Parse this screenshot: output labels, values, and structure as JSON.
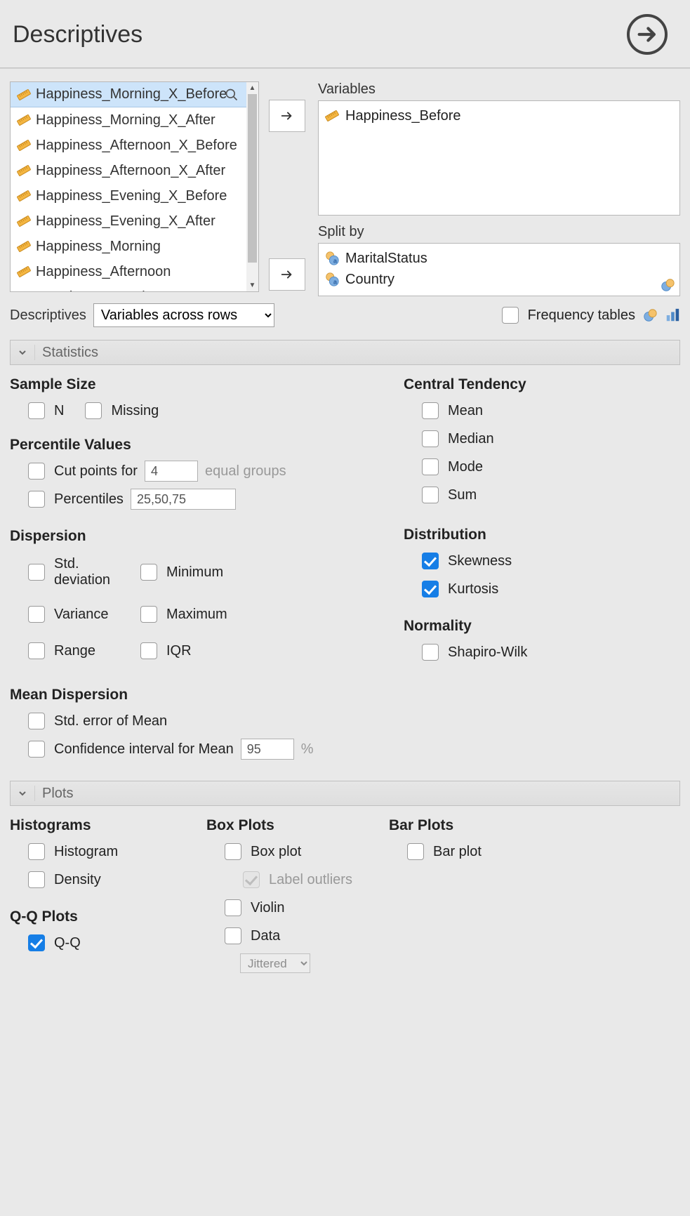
{
  "header": {
    "title": "Descriptives"
  },
  "source_vars": [
    "Happiness_Morning_X_Before",
    "Happiness_Morning_X_After",
    "Happiness_Afternoon_X_Before",
    "Happiness_Afternoon_X_After",
    "Happiness_Evening_X_Before",
    "Happiness_Evening_X_After",
    "Happiness_Morning",
    "Happiness_Afternoon",
    "Happiness_Evening"
  ],
  "targets": {
    "variables_label": "Variables",
    "variables": [
      "Happiness_Before"
    ],
    "split_label": "Split by",
    "split": [
      "MaritalStatus",
      "Country"
    ]
  },
  "layout_row": {
    "label": "Descriptives",
    "combo_value": "Variables across rows",
    "freq_label": "Frequency tables"
  },
  "sections": {
    "statistics": {
      "title": "Statistics",
      "sample_size": {
        "title": "Sample Size",
        "n": "N",
        "missing": "Missing"
      },
      "percentile": {
        "title": "Percentile Values",
        "cutpoints": "Cut points for",
        "cutpoints_val": "4",
        "equal_groups": "equal groups",
        "percentiles": "Percentiles",
        "percentiles_val": "25,50,75"
      },
      "dispersion": {
        "title": "Dispersion",
        "std": "Std. deviation",
        "min": "Minimum",
        "var": "Variance",
        "max": "Maximum",
        "range": "Range",
        "iqr": "IQR"
      },
      "mean_disp": {
        "title": "Mean Dispersion",
        "se": "Std. error of Mean",
        "ci": "Confidence interval for Mean",
        "ci_val": "95",
        "pct": "%"
      },
      "central": {
        "title": "Central Tendency",
        "mean": "Mean",
        "median": "Median",
        "mode": "Mode",
        "sum": "Sum"
      },
      "distribution": {
        "title": "Distribution",
        "skew": "Skewness",
        "kurt": "Kurtosis"
      },
      "normality": {
        "title": "Normality",
        "sw": "Shapiro-Wilk"
      }
    },
    "plots": {
      "title": "Plots",
      "hist": {
        "title": "Histograms",
        "histogram": "Histogram",
        "density": "Density"
      },
      "qq": {
        "title": "Q-Q Plots",
        "qq": "Q-Q"
      },
      "box": {
        "title": "Box Plots",
        "boxplot": "Box plot",
        "label_outliers": "Label outliers",
        "violin": "Violin",
        "data": "Data",
        "data_combo": "Jittered"
      },
      "bar": {
        "title": "Bar Plots",
        "barplot": "Bar plot"
      }
    }
  }
}
